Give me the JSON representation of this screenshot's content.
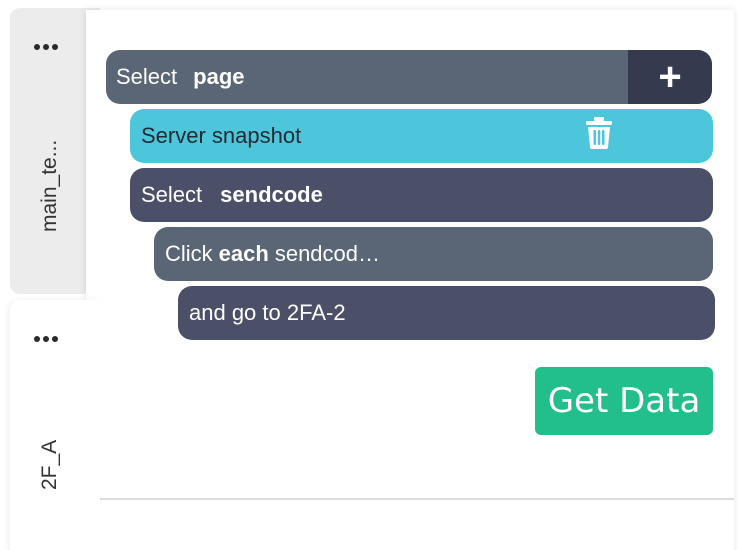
{
  "tabs": [
    {
      "label": "main_te...",
      "active": false
    },
    {
      "label": "2F_A",
      "active": true
    }
  ],
  "steps": {
    "select_page": {
      "prefix": "Select",
      "keyword": "page"
    },
    "snapshot": {
      "label": "Server snapshot"
    },
    "select_sendcode": {
      "prefix": "Select",
      "keyword": "sendcode"
    },
    "click_each": {
      "prefix": "Click",
      "keyword": "each",
      "suffix": "sendcod…"
    },
    "goto": {
      "label": "and go to 2FA-2"
    }
  },
  "actions": {
    "add_label": "+",
    "get_data_label": "Get Data"
  },
  "colors": {
    "accent_green": "#22bf8c",
    "snapshot_cyan": "#4dc6db",
    "row_slate": "#5a6675",
    "row_navy": "#4b5068",
    "add_dark": "#353a4f"
  },
  "icons": [
    "more-dots-icon",
    "plus-icon",
    "trash-icon"
  ]
}
